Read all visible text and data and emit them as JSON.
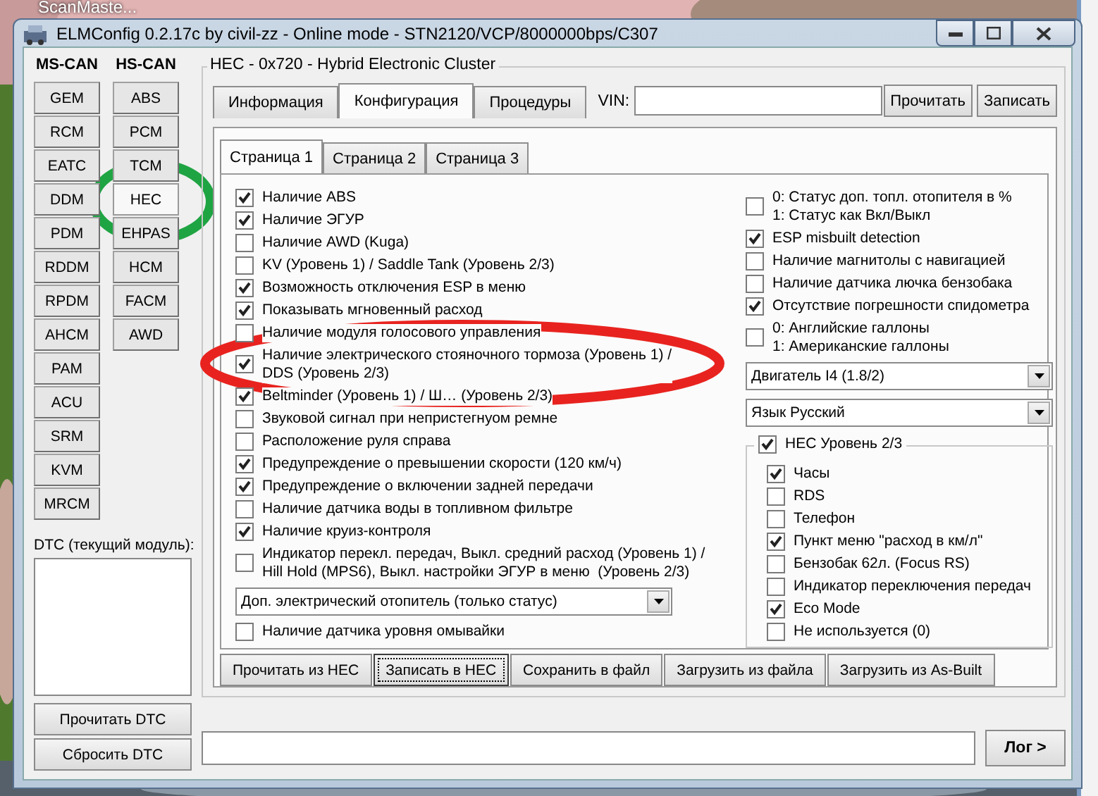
{
  "desktop": {
    "icon_label": "ScanMaste..."
  },
  "window": {
    "title": "ELMConfig 0.2.17c by civil-zz - Online mode - STN2120/VCP/8000000bps/C307"
  },
  "modules": {
    "ms_can": {
      "label": "MS-CAN",
      "buttons": [
        {
          "label": "GEM",
          "selected": false
        },
        {
          "label": "RCM",
          "selected": false
        },
        {
          "label": "EATC",
          "selected": false
        },
        {
          "label": "DDM",
          "selected": false
        },
        {
          "label": "PDM",
          "selected": false
        },
        {
          "label": "RDDM",
          "selected": false
        },
        {
          "label": "RPDM",
          "selected": false
        },
        {
          "label": "AHCM",
          "selected": false
        },
        {
          "label": "PAM",
          "selected": false
        },
        {
          "label": "ACU",
          "selected": false
        },
        {
          "label": "SRM",
          "selected": false
        },
        {
          "label": "KVM",
          "selected": false
        },
        {
          "label": "MRCM",
          "selected": false
        }
      ]
    },
    "hs_can": {
      "label": "HS-CAN",
      "buttons": [
        {
          "label": "ABS",
          "selected": false
        },
        {
          "label": "PCM",
          "selected": false
        },
        {
          "label": "TCM",
          "selected": false
        },
        {
          "label": "HEC",
          "selected": true,
          "circle": {
            "color": "#1fa443"
          }
        },
        {
          "label": "EHPAS",
          "selected": false
        },
        {
          "label": "HCM",
          "selected": false
        },
        {
          "label": "FACM",
          "selected": false
        },
        {
          "label": "AWD",
          "selected": false
        }
      ]
    }
  },
  "dtc": {
    "label": "DTC (текущий модуль):",
    "buttons": [
      "Прочитать DTC",
      "Сбросить DTC"
    ]
  },
  "module_group": {
    "title": "HEC - 0x720 - Hybrid Electronic Cluster"
  },
  "tabs": [
    {
      "label": "Информация",
      "selected": false
    },
    {
      "label": "Конфигурация",
      "selected": true
    },
    {
      "label": "Процедуры",
      "selected": false
    }
  ],
  "vin": {
    "label": "VIN:",
    "buttons": [
      "Прочитать",
      "Записать"
    ]
  },
  "pages": [
    {
      "label": "Страница 1",
      "selected": true
    },
    {
      "label": "Страница 2",
      "selected": false
    },
    {
      "label": "Страница 3",
      "selected": false
    }
  ],
  "left_options": [
    {
      "kind": "checkbox",
      "label": "Наличие ABS",
      "checked": true
    },
    {
      "kind": "checkbox",
      "label": "Наличие ЭГУР",
      "checked": true
    },
    {
      "kind": "checkbox",
      "label": "Наличие AWD (Kuga)",
      "checked": false
    },
    {
      "kind": "checkbox",
      "label": "KV (Уровень 1) / Saddle Tank (Уровень 2/3)",
      "checked": false
    },
    {
      "kind": "checkbox",
      "label": "Возможность отключения ESP в меню",
      "checked": true
    },
    {
      "kind": "checkbox",
      "label": "Показывать мгновенный расход",
      "checked": true
    },
    {
      "kind": "checkbox",
      "label": "Наличие модуля голосового управления",
      "checked": false
    },
    {
      "kind": "checkbox",
      "label": "Наличие электрического стояночного тормоза (Уровень 1) /\nDDS (Уровень 2/3)",
      "checked": true,
      "circle": {
        "color": "#e8231f"
      }
    },
    {
      "kind": "checkbox",
      "label": "Beltminder (Уровень 1) / Ш… (Уровень 2/3)",
      "checked": true
    },
    {
      "kind": "checkbox",
      "label": "Звуковой сигнал при непристегнуом ремне",
      "checked": false
    },
    {
      "kind": "checkbox",
      "label": "Расположение руля справа",
      "checked": false
    },
    {
      "kind": "checkbox",
      "label": "Предупреждение о превышении скорости (120 км/ч)",
      "checked": true
    },
    {
      "kind": "checkbox",
      "label": "Предупреждение о включении задней передачи",
      "checked": true
    },
    {
      "kind": "checkbox",
      "label": "Наличие датчика воды в топливном фильтре",
      "checked": false
    },
    {
      "kind": "checkbox",
      "label": "Наличие круиз-контроля",
      "checked": true
    },
    {
      "kind": "checkbox",
      "label": "Индикатор перекл. передач, Выкл. средний расход (Уровень 1) /\nHill Hold (MPS6), Выкл. настройки ЭГУР в меню  (Уровень 2/3)",
      "checked": false
    },
    {
      "kind": "dropdown",
      "value": "Доп. электрический отопитель (только статус)"
    },
    {
      "kind": "checkbox",
      "label": "Наличие датчика уровня омывайки",
      "checked": false
    }
  ],
  "right_options": [
    {
      "kind": "checkbox",
      "label": "0: Статус доп. топл. отопителя в %\n1: Статус как Вкл/Выкл",
      "checked": false
    },
    {
      "kind": "checkbox",
      "label": "ESP misbuilt detection",
      "checked": true
    },
    {
      "kind": "checkbox",
      "label": "Наличие магнитолы с навигацией",
      "checked": false
    },
    {
      "kind": "checkbox",
      "label": "Наличие датчика лючка бензобака",
      "checked": false
    },
    {
      "kind": "checkbox",
      "label": "Отсутствие погрешности спидометра",
      "checked": true
    },
    {
      "kind": "checkbox",
      "label": "0: Английские галлоны\n1: Американские галлоны",
      "checked": false
    },
    {
      "kind": "dropdown",
      "value": "Двигатель I4 (1.8/2)"
    },
    {
      "kind": "dropdown",
      "value": "Язык Русский"
    }
  ],
  "hec_group": {
    "label": "HEC Уровень 2/3",
    "checked": true,
    "items": [
      {
        "label": "Часы",
        "checked": true
      },
      {
        "label": "RDS",
        "checked": false
      },
      {
        "label": "Телефон",
        "checked": false
      },
      {
        "label": "Пункт меню \"расход в км/л\"",
        "checked": true
      },
      {
        "label": "Бензобак 62л. (Focus RS)",
        "checked": false
      },
      {
        "label": "Индикатор переключения передач",
        "checked": false
      },
      {
        "label": "Eco Mode",
        "checked": true
      },
      {
        "label": "Не используется (0)",
        "checked": false
      }
    ]
  },
  "actions": [
    {
      "label": "Прочитать из HEC",
      "focused": false
    },
    {
      "label": "Записать в HEC",
      "focused": true
    },
    {
      "label": "Сохранить в файл",
      "focused": false
    },
    {
      "label": "Загрузить из файла",
      "focused": false
    },
    {
      "label": "Загрузить из As-Built",
      "focused": false
    }
  ],
  "log_button": "Лог >"
}
